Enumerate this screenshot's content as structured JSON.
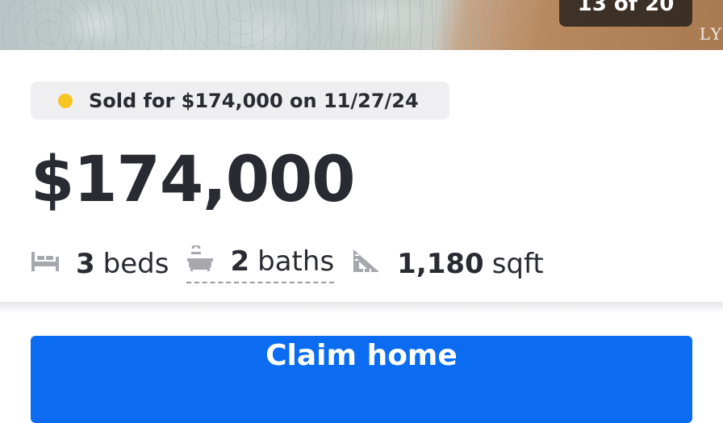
{
  "photo": {
    "counter": "13 of 20",
    "watermark": "LY"
  },
  "status": {
    "text": "Sold for $174,000 on 11/27/24",
    "dot_color": "#f5c523"
  },
  "price": "$174,000",
  "facts": {
    "beds": {
      "value": "3",
      "unit": "beds",
      "icon": "bed-icon"
    },
    "baths": {
      "value": "2",
      "unit": "baths",
      "icon": "bathtub-icon"
    },
    "sqft": {
      "value": "1,180",
      "unit": "sqft",
      "icon": "ruler-triangle-icon"
    }
  },
  "cta": {
    "label": "Claim home",
    "color": "#0b6cf2"
  }
}
